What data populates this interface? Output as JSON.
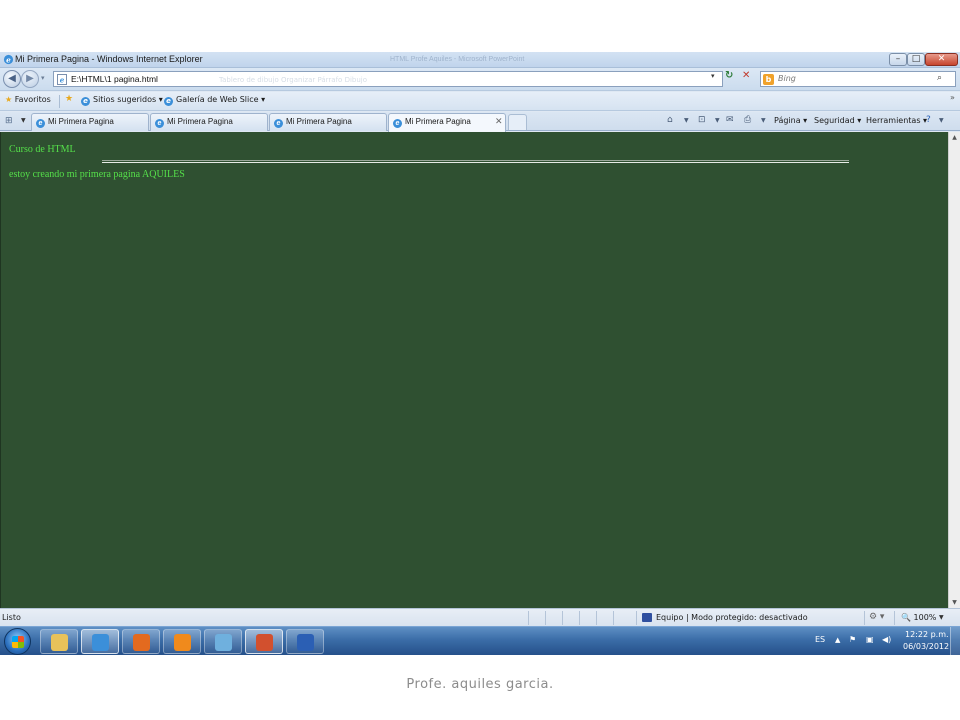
{
  "window": {
    "title": "Mi Primera Pagina - Windows Internet Explorer",
    "background_title": "HTML Profe Aquiles - Microsoft PowerPoint",
    "minimize_glyph": "–",
    "maximize_glyph": "□",
    "close_glyph": "✕"
  },
  "address_bar": {
    "url": "E:\\HTML\\1 pagina.html",
    "ghost_text": "Tablero de dibujo     Organizar      Párrafo      Dibujo",
    "back_icon": "back-arrow-icon",
    "forward_icon": "forward-arrow-icon",
    "search_placeholder": "Bing",
    "search_logo": "b"
  },
  "favorites_bar": {
    "favorites_label": "Favoritos",
    "items": [
      {
        "label": "Sitios sugeridos ▾"
      },
      {
        "label": "Galería de Web Slice ▾"
      }
    ]
  },
  "tabs": [
    {
      "label": "Mi Primera Pagina",
      "active": false
    },
    {
      "label": "Mi Primera Pagina",
      "active": false
    },
    {
      "label": "Mi Primera Pagina",
      "active": false
    },
    {
      "label": "Mi Primera Pagina",
      "active": true
    }
  ],
  "command_bar": {
    "pagina": "Página ▾",
    "seguridad": "Seguridad ▾",
    "herramientas": "Herramientas ▾"
  },
  "page": {
    "heading": "Curso de HTML",
    "paragraph": "estoy creando mi primera pagina AQUILES",
    "background_color": "#2f5031",
    "text_color": "#55e04a"
  },
  "status_bar": {
    "status": "Listo",
    "zone": "Equipo | Modo protegido: desactivado",
    "zoom": "100%"
  },
  "taskbar": {
    "icons": [
      {
        "name": "explorer-icon",
        "color": "#e8c25a",
        "active": false
      },
      {
        "name": "internet-explorer-icon",
        "color": "#3b8fd9",
        "active": true
      },
      {
        "name": "firefox-icon",
        "color": "#e36a1f",
        "active": false
      },
      {
        "name": "media-player-icon",
        "color": "#f08a1c",
        "active": false
      },
      {
        "name": "notepad-icon",
        "color": "#6fb0de",
        "active": false
      },
      {
        "name": "powerpoint-icon",
        "color": "#d2502e",
        "active": true
      },
      {
        "name": "word-icon",
        "color": "#2b5fb4",
        "active": false
      }
    ],
    "language": "ES",
    "time": "12:22 p.m.",
    "date": "06/03/2012"
  },
  "caption": "Profe. aquiles garcia."
}
